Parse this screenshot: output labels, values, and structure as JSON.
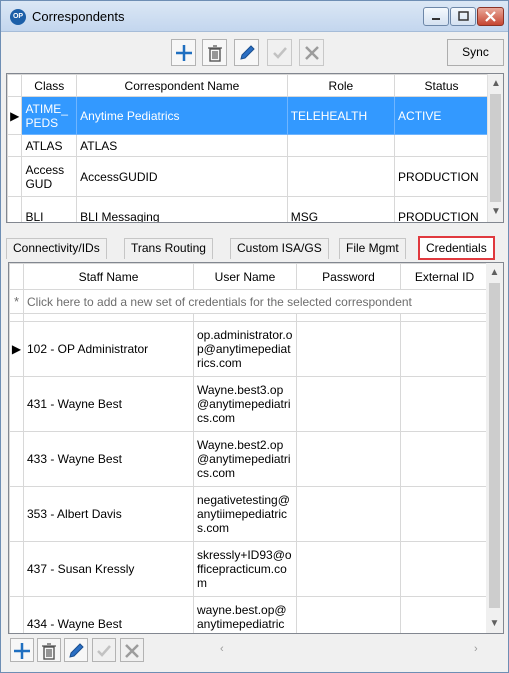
{
  "window": {
    "title": "Correspondents",
    "app_icon_text": "OP"
  },
  "toolbar": {
    "sync_label": "Sync"
  },
  "correspondents": {
    "columns": [
      "Class",
      "Correspondent Name",
      "Role",
      "Status"
    ],
    "rows": [
      {
        "class": "ATIME_PEDS",
        "name": "Anytime Pediatrics",
        "role": "TELEHEALTH",
        "status": "ACTIVE",
        "selected": true
      },
      {
        "class": "ATLAS",
        "name": "ATLAS",
        "role": "",
        "status": ""
      },
      {
        "class": "AccessGUD",
        "name": "AccessGUDID",
        "role": "",
        "status": "PRODUCTION"
      },
      {
        "class": "BLI",
        "name": "BLI Messaging",
        "role": "MSG",
        "status": "PRODUCTION"
      }
    ]
  },
  "tabs": [
    {
      "label": "Connectivity/IDs"
    },
    {
      "label": "Trans Routing"
    },
    {
      "label": "Custom ISA/GS"
    },
    {
      "label": "File Mgmt"
    },
    {
      "label": "Credentials",
      "active": true
    }
  ],
  "credentials": {
    "columns": [
      "Staff Name",
      "User Name",
      "Password",
      "External ID"
    ],
    "new_row_marker": "*",
    "new_row_text": "Click here to add a new set of credentials for the selected correspondent",
    "rows": [
      {
        "staff": "102 - OP Administrator",
        "user": "op.administrator.op@anytimepediatrics.com",
        "password": "",
        "external_id": "",
        "current": true
      },
      {
        "staff": "431 - Wayne Best",
        "user": "Wayne.best3.op@anytimepediatrics.com",
        "password": "",
        "external_id": ""
      },
      {
        "staff": "433 - Wayne Best",
        "user": "Wayne.best2.op@anytimepediatrics.com",
        "password": "",
        "external_id": ""
      },
      {
        "staff": "353 - Albert Davis",
        "user": "negativetesting@anytiimepediatrics.com",
        "password": "",
        "external_id": ""
      },
      {
        "staff": "437 - Susan Kressly",
        "user": "skressly+ID93@officepracticum.com",
        "password": "",
        "external_id": ""
      },
      {
        "staff": "434 - Wayne Best",
        "user": "wayne.best.op@anytimepediatrics.com",
        "password": "",
        "external_id": ""
      }
    ]
  },
  "colors": {
    "selection": "#3399ff",
    "active_tab_border": "#e0393e",
    "add_icon": "#1f6fc0",
    "edit_icon": "#2a6fc4"
  }
}
